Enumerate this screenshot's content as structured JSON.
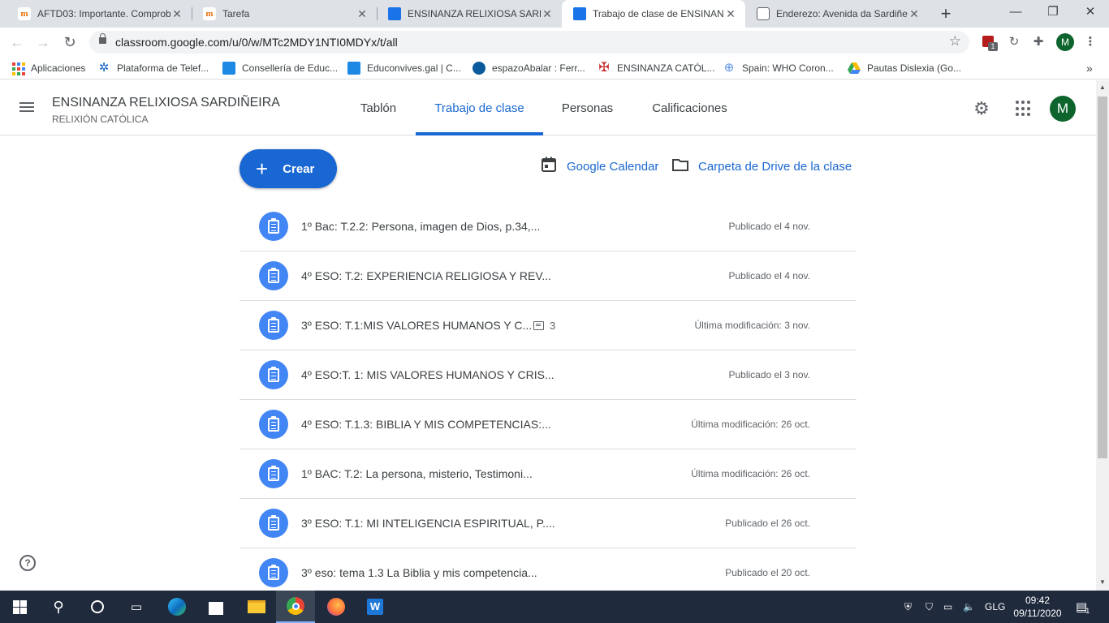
{
  "browser": {
    "tabs": [
      {
        "title": "AFTD03: Importante. Comprob",
        "icon": "moodle-icon"
      },
      {
        "title": "Tarefa",
        "icon": "moodle-icon"
      },
      {
        "title": "ENSINANZA RELIXIOSA SARDIÑ",
        "icon": "classroom-icon"
      },
      {
        "title": "Trabajo de clase de ENSINANZ",
        "icon": "classroom-icon",
        "active": true
      },
      {
        "title": "Enderezo: Avenida da Sardiñei",
        "icon": "document-icon"
      }
    ],
    "new_tab": "+",
    "url": "classroom.google.com/u/0/w/MTc2MDY1NTI0MDYx/t/all",
    "profile_initial": "M",
    "ext_badge": "1",
    "bookmarks": [
      "Aplicaciones",
      "Plataforma de Telef...",
      "Consellería de Educ...",
      "Educonvives.gal | C...",
      "espazoAbalar : Ferr...",
      "ENSINANZA CATÓL...",
      "Spain: WHO Coron...",
      "Pautas Dislexia (Go..."
    ],
    "bookmarks_more": "»"
  },
  "classroom": {
    "course_title": "ENSINANZA RELIXIOSA SARDIÑEIRA",
    "course_subtitle": "RELIXIÓN CATÓLICA",
    "tabs": [
      "Tablón",
      "Trabajo de clase",
      "Personas",
      "Calificaciones"
    ],
    "active_tab": "Trabajo de clase",
    "profile_initial": "M",
    "create_label": "Crear",
    "calendar_link": "Google Calendar",
    "drive_link": "Carpeta de Drive de la clase",
    "help": "?",
    "assignments": [
      {
        "title": "1º Bac: T.2.2: Persona, imagen de Dios, p.34,...",
        "date": "Publicado el 4 nov."
      },
      {
        "title": "4º ESO: T.2: EXPERIENCIA RELIGIOSA Y REV...",
        "date": "Publicado el 4 nov."
      },
      {
        "title": "3º ESO: T.1:MIS VALORES HUMANOS Y C...",
        "comments": "3",
        "date": "Última modificación: 3 nov."
      },
      {
        "title": "4º ESO:T. 1: MIS VALORES HUMANOS Y CRIS...",
        "date": "Publicado el 3 nov."
      },
      {
        "title": "4º ESO: T.1.3: BIBLIA Y MIS COMPETENCIAS:...",
        "date": "Última modificación: 26 oct."
      },
      {
        "title": "1º BAC: T.2: La persona, misterio, Testimoni...",
        "date": "Última modificación: 26 oct."
      },
      {
        "title": "3º ESO: T.1: MI INTELIGENCIA ESPIRITUAL, P....",
        "date": "Publicado el 26 oct."
      },
      {
        "title": "3º eso: tema 1.3 La Biblia y mis competencia...",
        "date": "Publicado el 20 oct."
      }
    ]
  },
  "taskbar": {
    "language": "GLG",
    "time": "09:42",
    "date": "09/11/2020",
    "notifications": "1"
  },
  "colors": {
    "accent": "#1967d2",
    "assignment_icon": "#4285f4",
    "taskbar": "#1f2a3c"
  }
}
